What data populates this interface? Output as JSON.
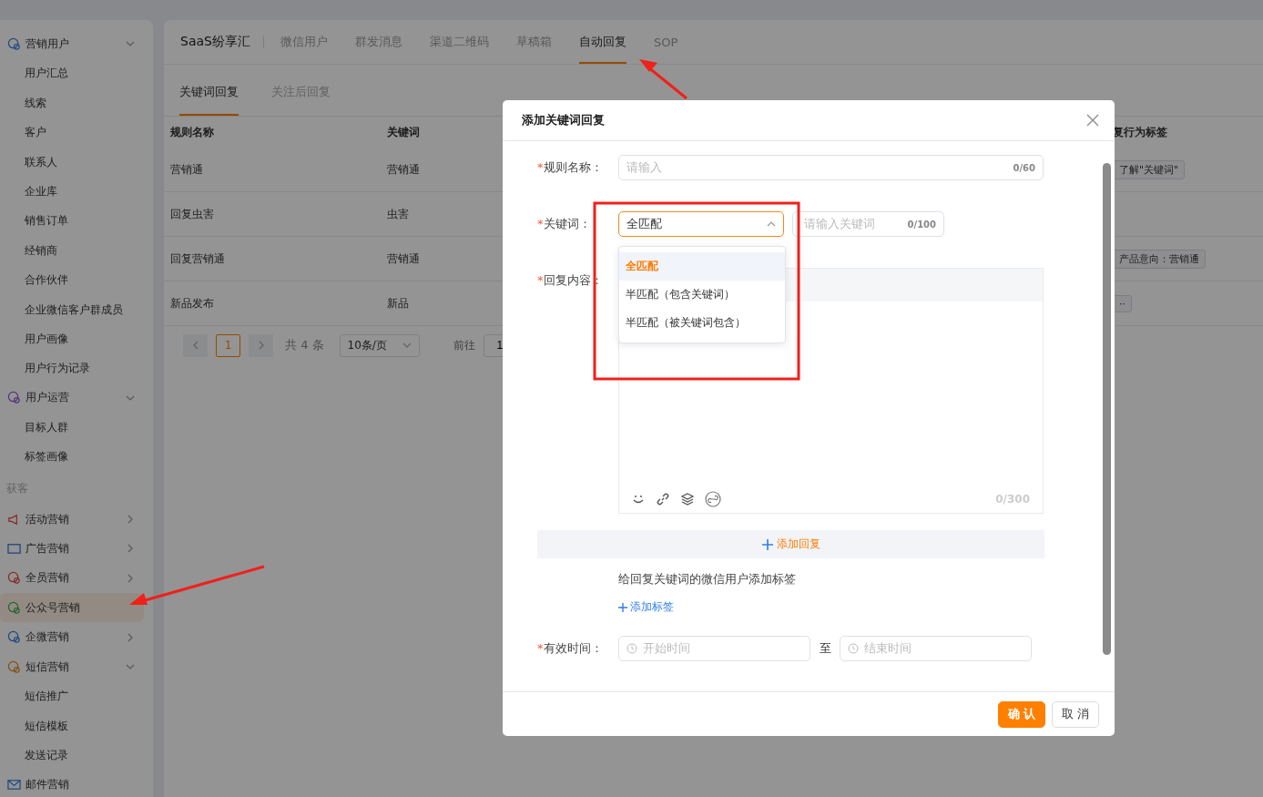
{
  "sidebar": {
    "items": [
      {
        "kind": "menu",
        "label": "营销用户",
        "selected": false,
        "expanded": true,
        "children": [
          {
            "label": "用户汇总",
            "selected": false
          },
          {
            "label": "线索",
            "selected": false
          },
          {
            "label": "客户",
            "selected": false
          },
          {
            "label": "联系人",
            "selected": false
          },
          {
            "label": "企业库",
            "selected": false
          },
          {
            "label": "销售订单",
            "selected": false
          },
          {
            "label": "经销商",
            "selected": false
          },
          {
            "label": "合作伙伴",
            "selected": false
          },
          {
            "label": "企业微信客户群成员",
            "selected": false
          },
          {
            "label": "用户画像",
            "selected": false
          },
          {
            "label": "用户行为记录",
            "selected": false
          }
        ]
      },
      {
        "kind": "menu",
        "label": "用户运营",
        "selected": false,
        "expanded": true,
        "children": [
          {
            "label": "目标人群",
            "selected": false
          },
          {
            "label": "标签画像",
            "selected": false
          }
        ]
      },
      {
        "kind": "section",
        "label": "获客"
      },
      {
        "kind": "menu",
        "label": "活动营销",
        "selected": false,
        "expanded": false
      },
      {
        "kind": "menu",
        "label": "广告营销",
        "selected": false,
        "expanded": false
      },
      {
        "kind": "menu",
        "label": "全员营销",
        "selected": false,
        "expanded": false
      },
      {
        "kind": "menu",
        "label": "公众号营销",
        "selected": true
      },
      {
        "kind": "menu",
        "label": "企微营销",
        "selected": false,
        "expanded": false
      },
      {
        "kind": "menu",
        "label": "短信营销",
        "selected": false,
        "expanded": true,
        "children": [
          {
            "label": "短信推广",
            "selected": false
          },
          {
            "label": "短信模板",
            "selected": false
          },
          {
            "label": "发送记录",
            "selected": false
          }
        ]
      },
      {
        "kind": "menu",
        "label": "邮件营销",
        "selected": false
      }
    ]
  },
  "brand": "SaaS纷享汇",
  "tabs": [
    {
      "label": "微信用户",
      "selected": false
    },
    {
      "label": "群发消息",
      "selected": false
    },
    {
      "label": "渠道二维码",
      "selected": false
    },
    {
      "label": "草稿箱",
      "selected": false
    },
    {
      "label": "自动回复",
      "selected": true
    },
    {
      "label": "SOP",
      "selected": false
    }
  ],
  "subtabs": [
    {
      "label": "关键词回复",
      "selected": true
    },
    {
      "label": "关注后回复",
      "selected": false
    }
  ],
  "table": {
    "columns": [
      "规则名称",
      "关键词",
      "复行为标签"
    ],
    "rows": [
      {
        "cells": [
          "营销通",
          "营销通"
        ],
        "tag": "了解\"关键词\""
      },
      {
        "cells": [
          "回复虫害",
          "虫害"
        ]
      },
      {
        "cells": [
          "回复营销通",
          "营销通"
        ],
        "tag": "产品意向：营销通"
      },
      {
        "cells": [
          "新品发布",
          "新品"
        ],
        "tag": "··"
      }
    ]
  },
  "pagination": {
    "pages": [
      {
        "label": "1",
        "selected": true
      }
    ],
    "total": "共 4 条",
    "page_size": "10条/页",
    "goto_label": "前往",
    "goto_value": "1"
  },
  "dialog": {
    "title": "添加关键词回复",
    "rule_name": {
      "required_mark": "*",
      "label": "规则名称：",
      "placeholder": "请输入",
      "counter": "0/60"
    },
    "keyword": {
      "required_mark": "*",
      "label": "关键词：",
      "match_value": "全匹配",
      "expanded": true,
      "options": [
        {
          "label": "全匹配",
          "selected": true
        },
        {
          "label": "半匹配（包含关键词）",
          "selected": false
        },
        {
          "label": "半匹配（被关键词包含）",
          "selected": false
        }
      ],
      "placeholder": "请输入关键词",
      "counter": "0/100"
    },
    "reply_content": {
      "required_mark": "*",
      "label": "回复内容：",
      "counter": "0/300"
    },
    "add_reply": "添加回复",
    "tag_hint": "给回复关键词的微信用户添加标签",
    "add_tag": "添加标签",
    "valid_time": {
      "required_mark": "*",
      "label": "有效时间：",
      "start_placeholder": "开始时间",
      "separator": "至",
      "end_placeholder": "结束时间"
    },
    "buttons": [
      {
        "label": "确 认",
        "kind": "primary"
      },
      {
        "label": "取 消",
        "kind": "secondary"
      }
    ]
  }
}
